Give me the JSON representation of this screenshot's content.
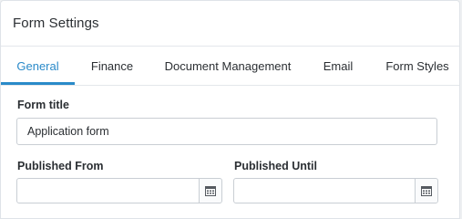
{
  "dialog": {
    "title": "Form Settings"
  },
  "tabs": [
    {
      "label": "General",
      "active": true
    },
    {
      "label": "Finance",
      "active": false
    },
    {
      "label": "Document Management",
      "active": false
    },
    {
      "label": "Email",
      "active": false
    },
    {
      "label": "Form Styles",
      "active": false
    }
  ],
  "general": {
    "form_title_label": "Form title",
    "form_title_value": "Application form",
    "published_from_label": "Published From",
    "published_from_value": "",
    "published_until_label": "Published Until",
    "published_until_value": ""
  },
  "icons": {
    "calendar": "calendar-icon"
  },
  "colors": {
    "accent": "#2a8ac9",
    "text": "#2b2f33",
    "border": "#c9ced4"
  }
}
